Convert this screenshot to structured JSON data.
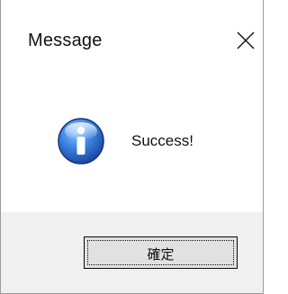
{
  "window": {
    "title": "Message",
    "close_icon": "close-icon"
  },
  "message": {
    "icon": "info-icon",
    "text": "Success!"
  },
  "buttons": {
    "ok_label": "確定"
  },
  "colors": {
    "content_bg": "#ffffff",
    "footer_bg": "#f0f0f0",
    "button_bg": "#e1e1e1",
    "icon_blue": "#2a6fd0"
  }
}
